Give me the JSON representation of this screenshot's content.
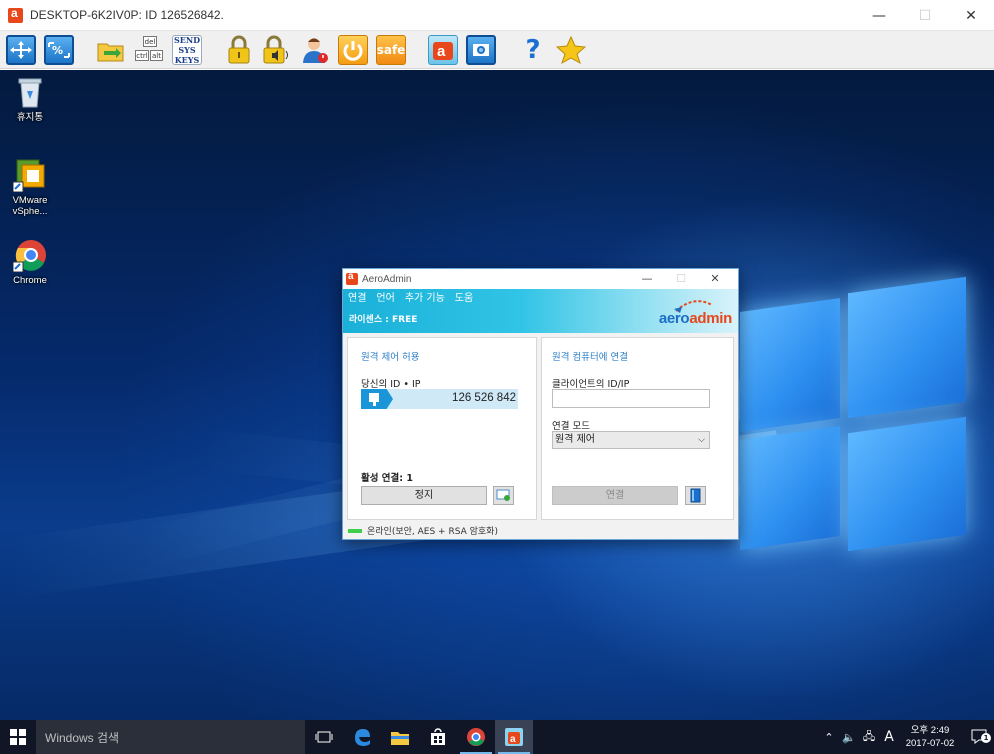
{
  "window": {
    "title": "DESKTOP-6K2IV0P: ID 126526842.",
    "minimize": "—",
    "maximize": "☐",
    "close": "✕"
  },
  "toolbar": {
    "send_sys_keys_label": "SEND SYS KEYS",
    "safe_label": "safe",
    "del_label": "del",
    "ctrl_label": "ctrl",
    "alt_label": "alt",
    "help_label": "?"
  },
  "desktop": {
    "icons": [
      {
        "label": "휴지통"
      },
      {
        "label": "VMware vSphe..."
      },
      {
        "label": "Chrome"
      }
    ]
  },
  "aeroadmin": {
    "title": "AeroAdmin",
    "menu": [
      "연결",
      "언어",
      "추가 기능",
      "도움"
    ],
    "license": "라이센스 : FREE",
    "logo_part1": "aero",
    "logo_part2": "admin",
    "left": {
      "section_title": "원격 제어 허용",
      "id_label": "당신의 ID • IP",
      "id_value": "126 526 842",
      "active_connections": "활성 연결: 1",
      "stop_button": "정지"
    },
    "right": {
      "section_title": "원격 컴퓨터에 연결",
      "client_id_label": "클라이언트의 ID/IP",
      "client_id_value": "",
      "mode_label": "연결 모드",
      "mode_value": "원격 제어",
      "connect_button": "연결"
    },
    "status": "온라인(보안, AES + RSA 암호화)"
  },
  "taskbar": {
    "search_placeholder": "Windows 검색",
    "time": "오후 2:49",
    "date": "2017-07-02",
    "ime": "A",
    "notification_count": "1"
  }
}
